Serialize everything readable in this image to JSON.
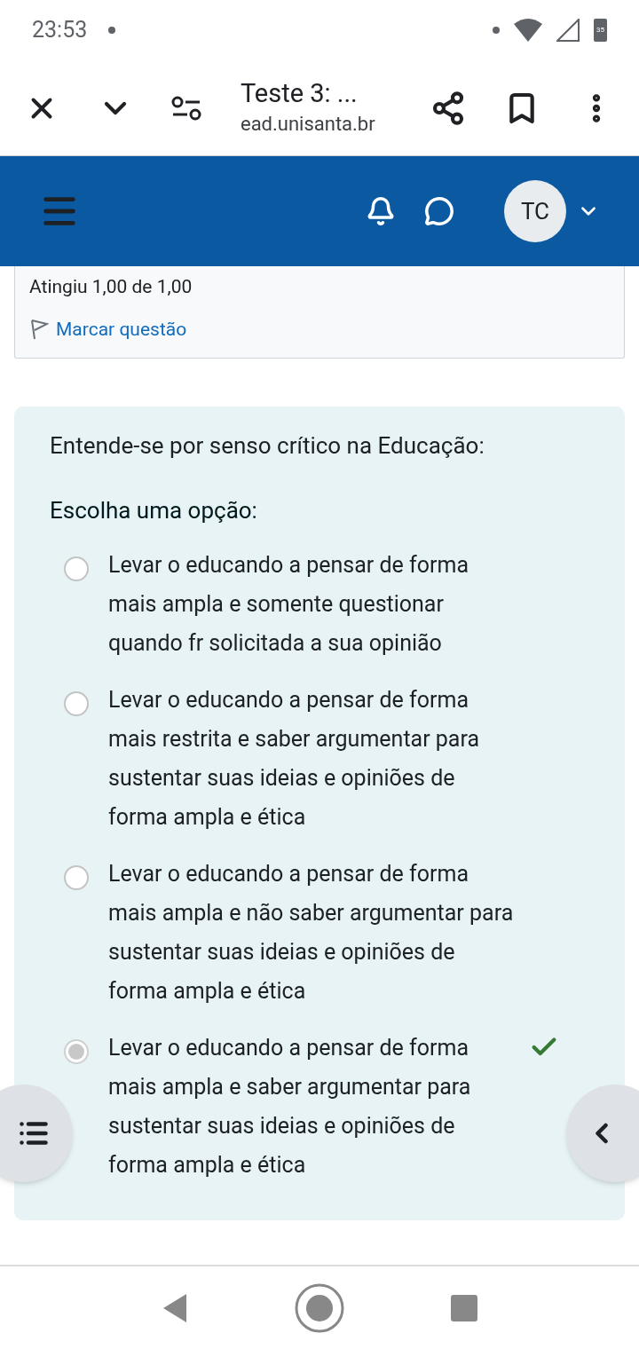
{
  "status_bar": {
    "time": "23:53",
    "battery": "35"
  },
  "browser": {
    "title": "Teste 3: ...",
    "url": "ead.unisanta.br"
  },
  "header": {
    "avatar": "TC"
  },
  "info_card": {
    "grade": "Atingiu 1,00 de 1,00",
    "flag_link": "Marcar questão"
  },
  "question": {
    "text": "Entende-se por senso crítico na Educação:",
    "prompt": "Escolha uma opção:",
    "options": [
      {
        "text": "Levar o educando a pensar de forma mais ampla e somente questionar quando fr solicitada a sua opinião",
        "selected": false,
        "correct": false
      },
      {
        "text": "Levar o educando a pensar de forma mais restrita e saber argumentar para sustentar suas ideias e opiniões de forma ampla e ética",
        "selected": false,
        "correct": false
      },
      {
        "text": "Levar o educando a pensar de forma mais ampla e não saber argumentar para sustentar suas ideias e opiniões de forma ampla e ética",
        "selected": false,
        "correct": false
      },
      {
        "text": "Levar o educando a pensar de forma mais ampla e saber argumentar para sustentar suas ideias e opiniões de forma ampla e ética",
        "selected": true,
        "correct": true
      }
    ]
  }
}
